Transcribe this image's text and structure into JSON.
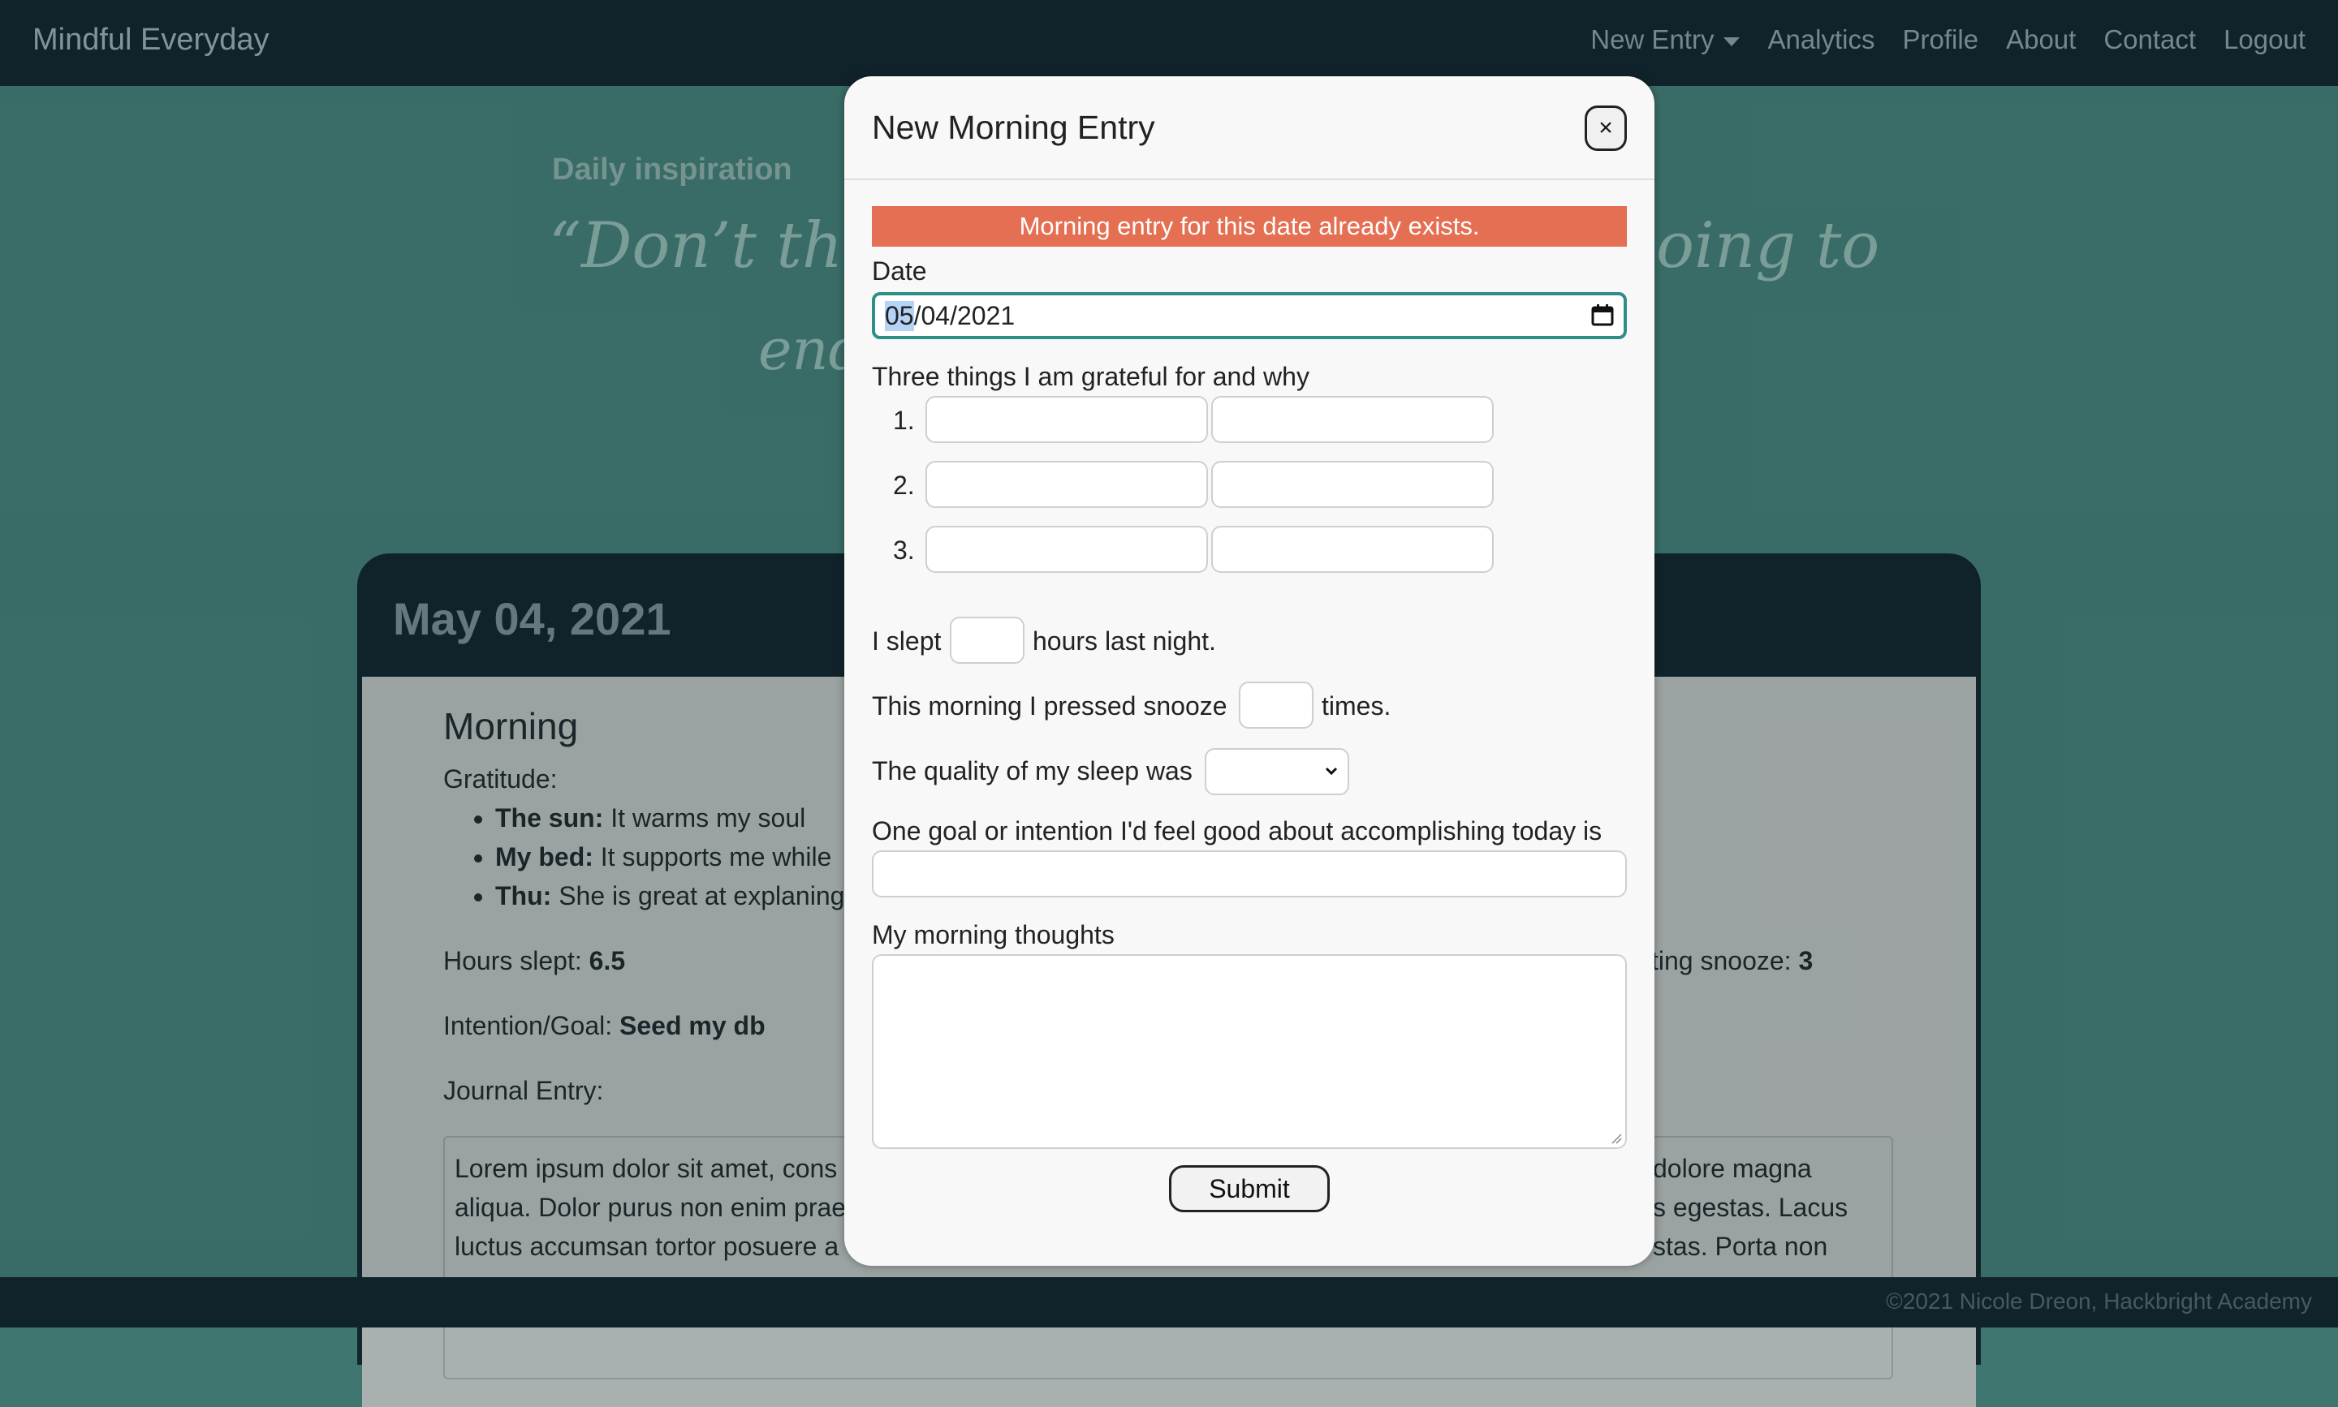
{
  "navbar": {
    "brand": "Mindful Everyday",
    "links": [
      "New Entry",
      "Analytics",
      "Profile",
      "About",
      "Contact",
      "Logout"
    ]
  },
  "hero": {
    "label": "Daily inspiration",
    "quote_visible_left": "“Don’t think",
    "quote_visible_right": "oing to",
    "quote_line2_fragment": "end"
  },
  "card": {
    "date": "May 04, 2021",
    "section_title": "Morning",
    "gratitude_label": "Gratitude:",
    "gratitude": [
      {
        "title": "The sun:",
        "text": "It warms my soul"
      },
      {
        "title": "My bed:",
        "text": "It supports me while"
      },
      {
        "title": "Thu:",
        "text": "She is great at explaning"
      }
    ],
    "hours_label": "Hours slept:",
    "hours_value": "6.5",
    "snooze_label": "itting snooze:",
    "snooze_value": "3",
    "goal_label": "Intention/Goal:",
    "goal_value": "Seed my db",
    "journal_label": "Journal Entry:",
    "journal_lines": [
      "Lorem ipsum dolor sit amet, cons",
      "aliqua. Dolor purus non enim prae",
      "luctus accumsan tortor posuere a"
    ],
    "journal_lines_right": [
      "dolore magna",
      "s egestas. Lacus",
      "stas. Porta non"
    ]
  },
  "footer": {
    "text": "©2021 Nicole Dreon, Hackbright Academy"
  },
  "modal": {
    "title": "New Morning Entry",
    "close_label": "×",
    "alert": "Morning entry for this date already exists.",
    "date_label": "Date",
    "date_value_selected": "05",
    "date_value_rest": "/04/2021",
    "grateful_label": "Three things I am grateful for and why",
    "row_numbers": [
      "1.",
      "2.",
      "3."
    ],
    "slept_prefix": "I slept",
    "slept_suffix": "hours last night.",
    "snooze_prefix": "This morning I pressed snooze",
    "snooze_suffix": "times.",
    "quality_label": "The quality of my sleep was",
    "quality_selected": "",
    "goal_label": "One goal or intention I'd feel good about accomplishing today is",
    "thoughts_label": "My morning thoughts",
    "submit_label": "Submit"
  },
  "colors": {
    "navbar": "#13262e",
    "page_bg": "#3f7670",
    "alert": "#e56f52",
    "focus_border": "#2f8f85"
  }
}
